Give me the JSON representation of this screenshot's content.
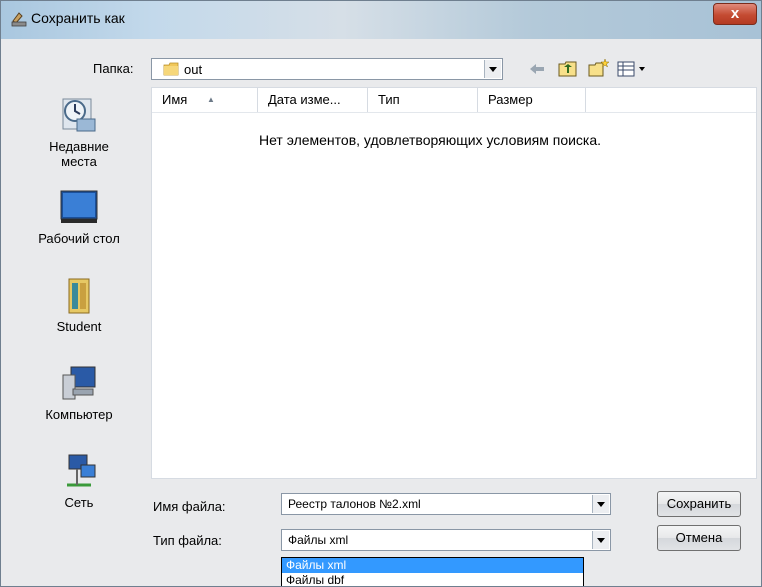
{
  "window": {
    "title": "Сохранить как",
    "close_label": "x"
  },
  "toolbar": {
    "folder_label": "Папка:",
    "folder_value": "out",
    "icons": [
      "back-arrow-icon",
      "up-folder-icon",
      "new-folder-icon",
      "views-menu-icon"
    ]
  },
  "places": [
    {
      "label": "Недавние места",
      "icon": "recent-places-icon"
    },
    {
      "label": "Рабочий стол",
      "icon": "desktop-icon"
    },
    {
      "label": "Student",
      "icon": "user-folder-icon"
    },
    {
      "label": "Компьютер",
      "icon": "computer-icon"
    },
    {
      "label": "Сеть",
      "icon": "network-icon"
    }
  ],
  "filelist": {
    "columns": [
      "Имя",
      "Дата изме...",
      "Тип",
      "Размер"
    ],
    "empty_message": "Нет элементов, удовлетворяющих условиям поиска."
  },
  "form": {
    "filename_label": "Имя файла:",
    "filename_value": "Реестр талонов №2.xml",
    "filetype_label": "Тип файла:",
    "filetype_value": "Файлы xml",
    "filetype_options": [
      "Файлы xml",
      "Файлы dbf"
    ],
    "filetype_selected_index": 0
  },
  "buttons": {
    "save": "Сохранить",
    "cancel": "Отмена"
  },
  "colors": {
    "selection": "#3399ff",
    "close_button": "#c44b32"
  }
}
